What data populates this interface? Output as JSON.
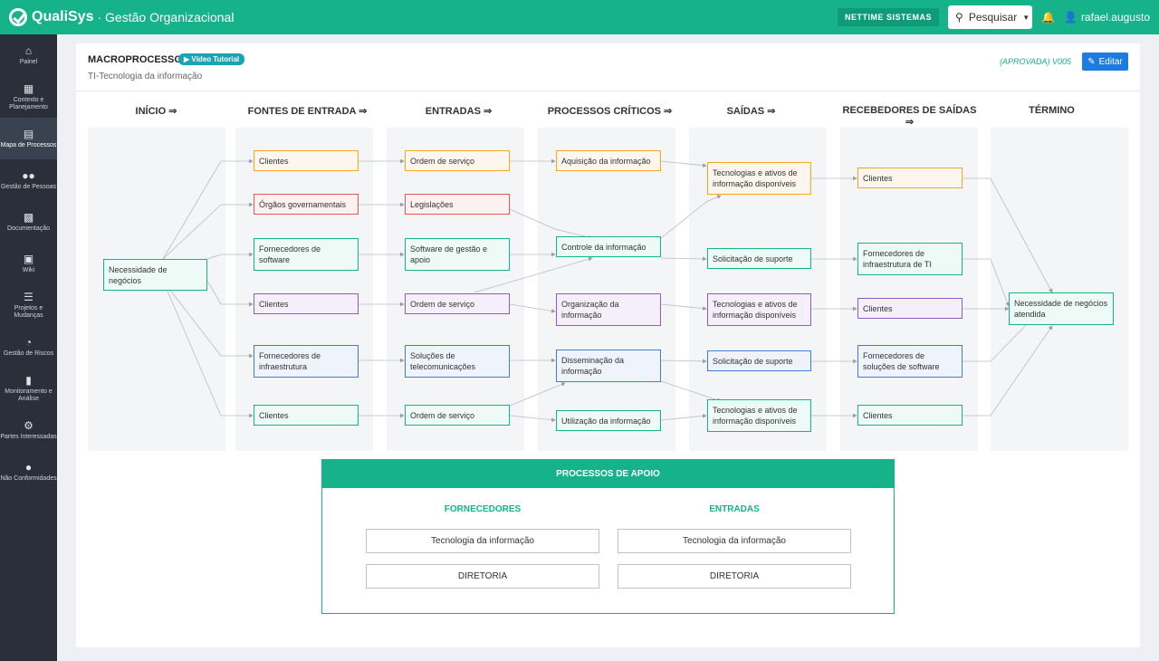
{
  "topbar": {
    "brand": "QualiSys",
    "subtitle": "· Gestão Organizacional",
    "company_button": "NETTIME SISTEMAS",
    "search_label": "Pesquisar",
    "username": "rafael.augusto"
  },
  "sidebar": {
    "items": [
      {
        "label": "Painel",
        "icon": "home-icon"
      },
      {
        "label": "Contexto e Planejamento",
        "icon": "sitemap-icon"
      },
      {
        "label": "Mapa de Processos",
        "icon": "map-icon"
      },
      {
        "label": "Gestão de Pessoas",
        "icon": "users-icon"
      },
      {
        "label": "Documentação",
        "icon": "document-icon"
      },
      {
        "label": "Wiki",
        "icon": "archive-icon"
      },
      {
        "label": "Projetos e Mudanças",
        "icon": "list-icon"
      },
      {
        "label": "Gestão de Riscos",
        "icon": "gauge-icon"
      },
      {
        "label": "Monitoramento e Análise",
        "icon": "chart-icon"
      },
      {
        "label": "Partes Interessadas",
        "icon": "user-cog-icon"
      },
      {
        "label": "Não Conformidades",
        "icon": "alert-icon"
      }
    ]
  },
  "header": {
    "title": "MACROPROCESSO",
    "video_badge": "Vídeo Tutorial",
    "subtitle": "TI-Tecnologia da informação",
    "status": "(APROVADA) V005",
    "edit_label": "Editar"
  },
  "columns": [
    "INÍCIO ⇒",
    "FONTES DE ENTRADA ⇒",
    "ENTRADAS ⇒",
    "PROCESSOS CRÍTICOS ⇒",
    "SAÍDAS ⇒",
    "RECEBEDORES DE SAÍDAS ⇒",
    "TÉRMINO"
  ],
  "boxes": {
    "inicio": "Necessidade de negócios",
    "fontes": [
      "Clientes",
      "Órgãos governamentais",
      "Fornecedores de software",
      "Clientes",
      "Fornecedores de infraestrutura",
      "Clientes"
    ],
    "entradas": [
      "Ordem de serviço",
      "Legislações",
      "Software de gestão e apoio",
      "Ordem de serviço",
      "Soluções de telecomunicações",
      "Ordem de serviço"
    ],
    "processos": [
      "Aquisição da informação",
      "Controle da informação",
      "Organização da informação",
      "Disseminação da informação",
      "Utilização da informação"
    ],
    "saidas": [
      "Tecnologias e ativos de informação disponíveis",
      "Solicitação de suporte",
      "Tecnologias e ativos de informação disponíveis",
      "Solicitação de suporte",
      "Tecnologias e ativos de informação disponíveis"
    ],
    "recebedores": [
      "Clientes",
      "Fornecedores de infraestrutura de TI",
      "Clientes",
      "Fornecedores de soluções de software",
      "Clientes"
    ],
    "termino": "Necessidade de negócios atendida"
  },
  "colors": {
    "orange": "#f5a623",
    "red": "#e05a5a",
    "green": "#16b28a",
    "purple": "#8e5cc7",
    "blue": "#3d7fd8"
  },
  "support": {
    "title": "PROCESSOS DE APOIO",
    "fornecedores_label": "FORNECEDORES",
    "entradas_label": "ENTRADAS",
    "fornecedores": [
      "Tecnologia da informação",
      "DIRETORIA"
    ],
    "entradas": [
      "Tecnologia da informação",
      "DIRETORIA"
    ]
  }
}
